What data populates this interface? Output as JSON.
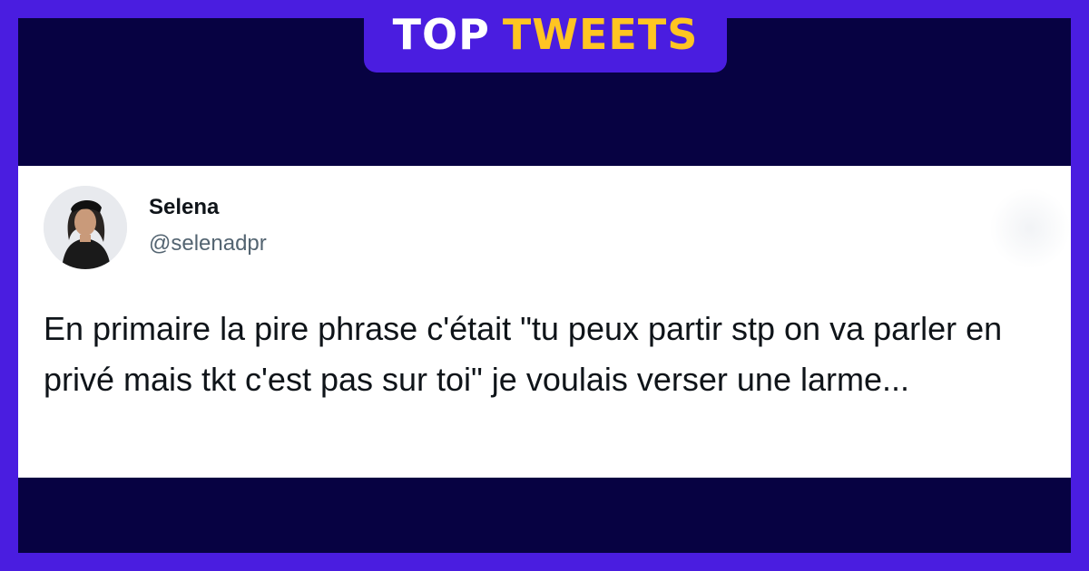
{
  "header": {
    "badge_word1": "TOP",
    "badge_word2": "TWEETS"
  },
  "colors": {
    "frame": "#4a1de0",
    "background": "#070242",
    "accent": "#ffc522",
    "card": "#ffffff"
  },
  "tweet": {
    "display_name": "Selena",
    "handle": "@selenadpr",
    "text": "En primaire la pire phrase c'était \"tu peux partir stp on va parler en privé mais tkt c'est pas sur toi\" je voulais verser une larme...",
    "avatar_icon": "user-avatar"
  }
}
